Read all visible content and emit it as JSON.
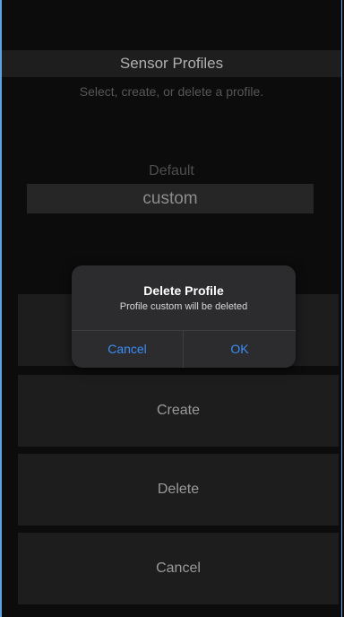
{
  "header": {
    "title": "Sensor Profiles",
    "subtitle": "Select, create, or delete a profile."
  },
  "picker": {
    "options": [
      "Default",
      "custom"
    ],
    "selected": "custom"
  },
  "actions": {
    "create_label": "Create",
    "delete_label": "Delete",
    "cancel_label": "Cancel"
  },
  "dialog": {
    "title": "Delete Profile",
    "message": "Profile custom will be deleted",
    "cancel_label": "Cancel",
    "ok_label": "OK"
  },
  "colors": {
    "accent": "#3a8ef6",
    "dialog_background": "#2c2c2e",
    "screen_background": "#0c0c0c"
  }
}
